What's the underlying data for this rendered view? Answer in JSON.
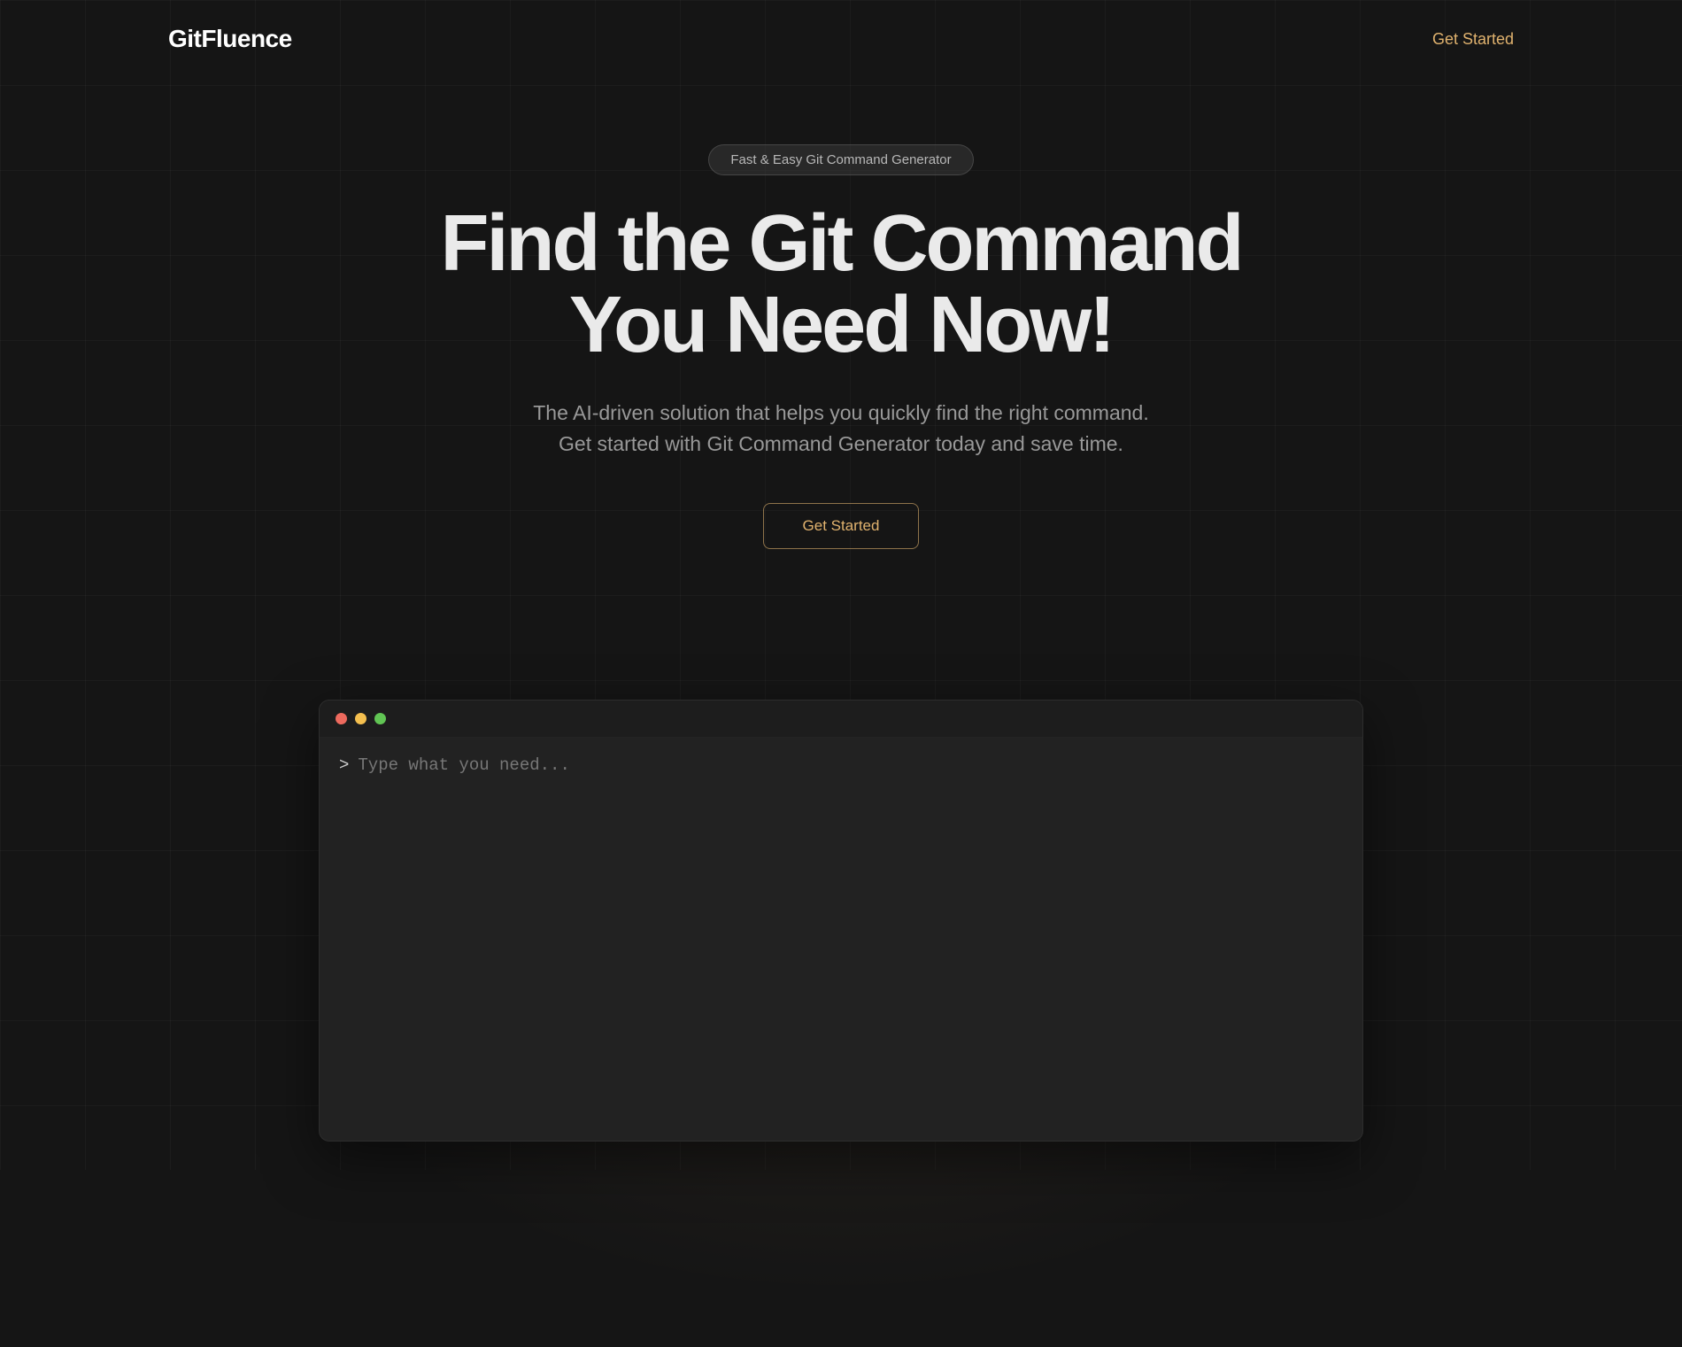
{
  "header": {
    "logo": "GitFluence",
    "nav_link": "Get Started"
  },
  "hero": {
    "badge": "Fast & Easy Git Command Generator",
    "title_line1": "Find the Git Command",
    "title_line2": "You Need Now!",
    "subtitle_line1": "The AI-driven solution that helps you quickly find the right command.",
    "subtitle_line2": "Get started with Git Command Generator today and save time.",
    "cta_label": "Get Started"
  },
  "terminal": {
    "prompt": ">",
    "placeholder": "Type what you need..."
  }
}
